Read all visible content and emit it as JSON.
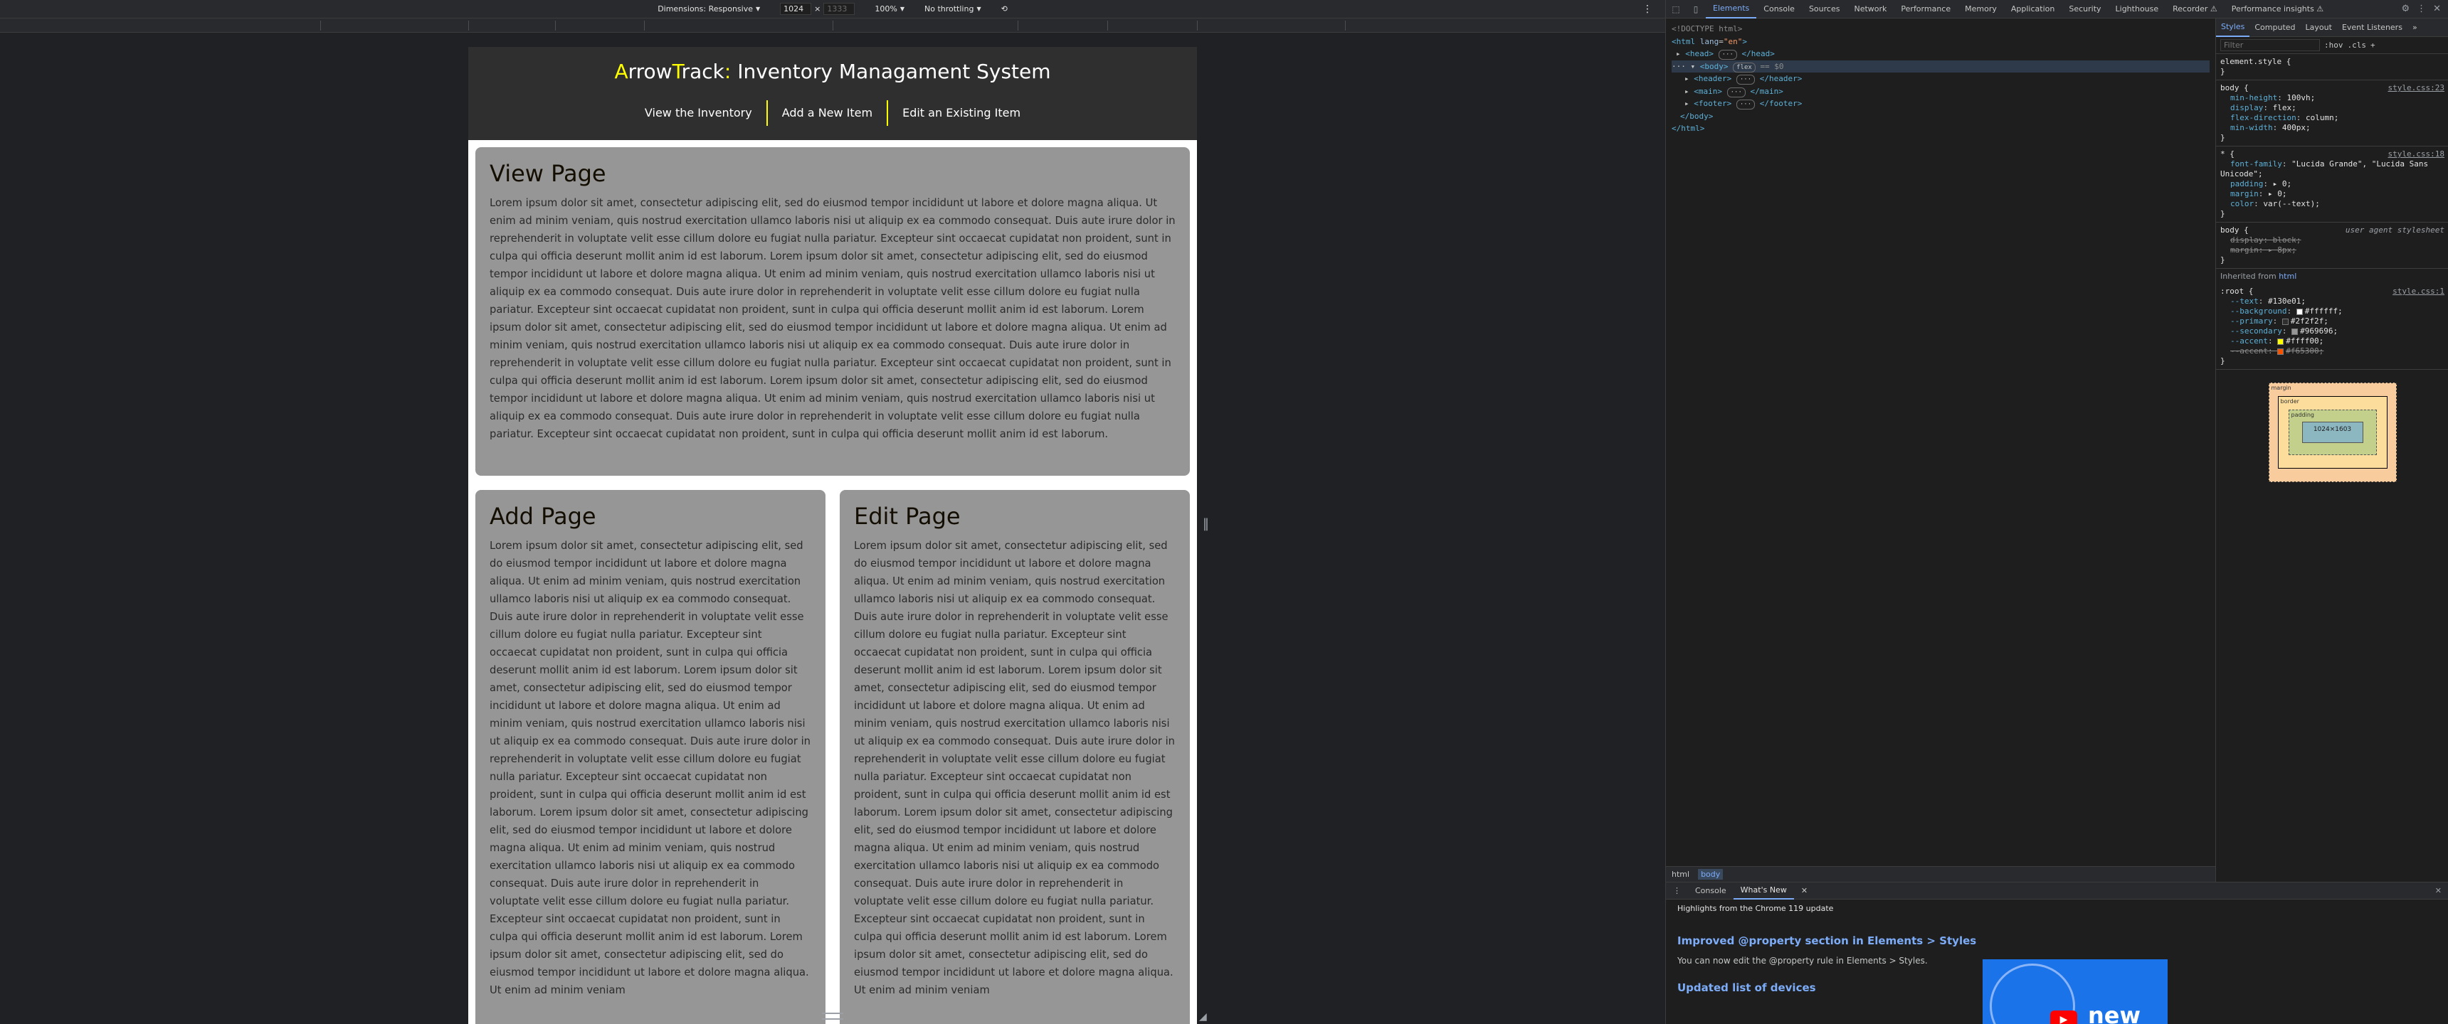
{
  "device_toolbar": {
    "dimensions_label": "Dimensions: Responsive",
    "width": "1024",
    "height": "1333",
    "separator": "×",
    "zoom": "100%",
    "throttling": "No throttling"
  },
  "site": {
    "title_first_letter": "A",
    "title_rrow": "rrow",
    "title_t": "T",
    "title_rack": "rack",
    "title_colon": ":",
    "title_rest": " Inventory Managament System",
    "nav": [
      "View the Inventory",
      "Add a New Item",
      "Edit an Existing Item"
    ],
    "view_card": {
      "heading": "View Page",
      "text": "Lorem ipsum dolor sit amet, consectetur adipiscing elit, sed do eiusmod tempor incididunt ut labore et dolore magna aliqua. Ut enim ad minim veniam, quis nostrud exercitation ullamco laboris nisi ut aliquip ex ea commodo consequat. Duis aute irure dolor in reprehenderit in voluptate velit esse cillum dolore eu fugiat nulla pariatur. Excepteur sint occaecat cupidatat non proident, sunt in culpa qui officia deserunt mollit anim id est laborum. Lorem ipsum dolor sit amet, consectetur adipiscing elit, sed do eiusmod tempor incididunt ut labore et dolore magna aliqua. Ut enim ad minim veniam, quis nostrud exercitation ullamco laboris nisi ut aliquip ex ea commodo consequat. Duis aute irure dolor in reprehenderit in voluptate velit esse cillum dolore eu fugiat nulla pariatur. Excepteur sint occaecat cupidatat non proident, sunt in culpa qui officia deserunt mollit anim id est laborum. Lorem ipsum dolor sit amet, consectetur adipiscing elit, sed do eiusmod tempor incididunt ut labore et dolore magna aliqua. Ut enim ad minim veniam, quis nostrud exercitation ullamco laboris nisi ut aliquip ex ea commodo consequat. Duis aute irure dolor in reprehenderit in voluptate velit esse cillum dolore eu fugiat nulla pariatur. Excepteur sint occaecat cupidatat non proident, sunt in culpa qui officia deserunt mollit anim id est laborum. Lorem ipsum dolor sit amet, consectetur adipiscing elit, sed do eiusmod tempor incididunt ut labore et dolore magna aliqua. Ut enim ad minim veniam, quis nostrud exercitation ullamco laboris nisi ut aliquip ex ea commodo consequat. Duis aute irure dolor in reprehenderit in voluptate velit esse cillum dolore eu fugiat nulla pariatur. Excepteur sint occaecat cupidatat non proident, sunt in culpa qui officia deserunt mollit anim id est laborum."
    },
    "add_card": {
      "heading": "Add Page",
      "text": "Lorem ipsum dolor sit amet, consectetur adipiscing elit, sed do eiusmod tempor incididunt ut labore et dolore magna aliqua. Ut enim ad minim veniam, quis nostrud exercitation ullamco laboris nisi ut aliquip ex ea commodo consequat. Duis aute irure dolor in reprehenderit in voluptate velit esse cillum dolore eu fugiat nulla pariatur. Excepteur sint occaecat cupidatat non proident, sunt in culpa qui officia deserunt mollit anim id est laborum. Lorem ipsum dolor sit amet, consectetur adipiscing elit, sed do eiusmod tempor incididunt ut labore et dolore magna aliqua. Ut enim ad minim veniam, quis nostrud exercitation ullamco laboris nisi ut aliquip ex ea commodo consequat. Duis aute irure dolor in reprehenderit in voluptate velit esse cillum dolore eu fugiat nulla pariatur. Excepteur sint occaecat cupidatat non proident, sunt in culpa qui officia deserunt mollit anim id est laborum. Lorem ipsum dolor sit amet, consectetur adipiscing elit, sed do eiusmod tempor incididunt ut labore et dolore magna aliqua. Ut enim ad minim veniam, quis nostrud exercitation ullamco laboris nisi ut aliquip ex ea commodo consequat. Duis aute irure dolor in reprehenderit in voluptate velit esse cillum dolore eu fugiat nulla pariatur. Excepteur sint occaecat cupidatat non proident, sunt in culpa qui officia deserunt mollit anim id est laborum. Lorem ipsum dolor sit amet, consectetur adipiscing elit, sed do eiusmod tempor incididunt ut labore et dolore magna aliqua. Ut enim ad minim veniam"
    },
    "edit_card": {
      "heading": "Edit Page",
      "text": "Lorem ipsum dolor sit amet, consectetur adipiscing elit, sed do eiusmod tempor incididunt ut labore et dolore magna aliqua. Ut enim ad minim veniam, quis nostrud exercitation ullamco laboris nisi ut aliquip ex ea commodo consequat. Duis aute irure dolor in reprehenderit in voluptate velit esse cillum dolore eu fugiat nulla pariatur. Excepteur sint occaecat cupidatat non proident, sunt in culpa qui officia deserunt mollit anim id est laborum. Lorem ipsum dolor sit amet, consectetur adipiscing elit, sed do eiusmod tempor incididunt ut labore et dolore magna aliqua. Ut enim ad minim veniam, quis nostrud exercitation ullamco laboris nisi ut aliquip ex ea commodo consequat. Duis aute irure dolor in reprehenderit in voluptate velit esse cillum dolore eu fugiat nulla pariatur. Excepteur sint occaecat cupidatat non proident, sunt in culpa qui officia deserunt mollit anim id est laborum. Lorem ipsum dolor sit amet, consectetur adipiscing elit, sed do eiusmod tempor incididunt ut labore et dolore magna aliqua. Ut enim ad minim veniam, quis nostrud exercitation ullamco laboris nisi ut aliquip ex ea commodo consequat. Duis aute irure dolor in reprehenderit in voluptate velit esse cillum dolore eu fugiat nulla pariatur. Excepteur sint occaecat cupidatat non proident, sunt in culpa qui officia deserunt mollit anim id est laborum. Lorem ipsum dolor sit amet, consectetur adipiscing elit, sed do eiusmod tempor incididunt ut labore et dolore magna aliqua. Ut enim ad minim veniam"
    },
    "colors": {
      "header_bg": "#2f2f2f",
      "card_bg": "#969696",
      "accent": "#ffff00",
      "text": "#130e01"
    }
  },
  "devtools": {
    "tabs": [
      "Elements",
      "Console",
      "Sources",
      "Network",
      "Performance",
      "Memory",
      "Application",
      "Security",
      "Lighthouse",
      "Recorder ⚠",
      "Performance insights ⚠"
    ],
    "active_tab": "Elements",
    "dom": {
      "doctype": "<!DOCTYPE html>",
      "html_open_tag": "html",
      "html_lang_attr": "lang",
      "html_lang_val": "\"en\"",
      "head": "head",
      "head_close": "</head>",
      "body": "body",
      "body_badge": "flex",
      "body_ref": "== $0",
      "header": "header",
      "header_close": "</header>",
      "main": "main",
      "main_close": "</main>",
      "footer": "footer",
      "footer_close": "</footer>",
      "body_close": "</body>",
      "html_close": "</html>",
      "ellipsis": "···"
    },
    "breadcrumbs": [
      "html",
      "body"
    ],
    "styles_tabs": [
      "Styles",
      "Computed",
      "Layout",
      "Event Listeners",
      "»"
    ],
    "styles_filter_placeholder": "Filter",
    "styles_tools": [
      ":hov",
      ".cls",
      "+"
    ],
    "rules": {
      "element_style": {
        "selector": "element.style {",
        "close": "}"
      },
      "body_rule": {
        "selector": "body {",
        "source": "style.css:23",
        "props": [
          {
            "name": "min-height",
            "value": "100vh;"
          },
          {
            "name": "display",
            "value": "flex;"
          },
          {
            "name": "flex-direction",
            "value": "column;"
          },
          {
            "name": "min-width",
            "value": "400px;"
          }
        ],
        "close": "}"
      },
      "star_rule": {
        "selector": "* {",
        "source": "style.css:18",
        "props": [
          {
            "name": "font-family",
            "value": "\"Lucida Grande\", \"Lucida Sans Unicode\";"
          },
          {
            "name": "padding",
            "value": "▸ 0;"
          },
          {
            "name": "margin",
            "value": "▸ 0;"
          },
          {
            "name": "color",
            "value": "var(--text);"
          }
        ],
        "close": "}"
      },
      "ua_rule": {
        "selector": "body {",
        "source": "user agent stylesheet",
        "props": [
          {
            "name": "display",
            "value": "block;"
          },
          {
            "name": "margin",
            "value": "▸ 8px;"
          }
        ],
        "close": "}"
      },
      "inherited_label": "Inherited from",
      "inherited_from": "html",
      "root_rule": {
        "selector": ":root {",
        "source": "style.css:1",
        "props": [
          {
            "name": "--text",
            "value": "#130e01;",
            "swatch": ""
          },
          {
            "name": "--background",
            "value": "#ffffff;",
            "swatch": "#ffffff"
          },
          {
            "name": "--primary",
            "value": "#2f2f2f;",
            "swatch": "#2f2f2f"
          },
          {
            "name": "--secondary",
            "value": "#969696;",
            "swatch": "#969696"
          },
          {
            "name": "--accent",
            "value": "#ffff00;",
            "swatch": "#ffff00"
          },
          {
            "name": "--accent",
            "value": "#f65300;",
            "swatch": "#f65300"
          }
        ],
        "close": "}"
      }
    },
    "box_model": {
      "margin_label": "margin",
      "border_label": "border",
      "padding_label": "padding",
      "content": "1024×1603",
      "dash": "-"
    },
    "drawer": {
      "tabs": [
        "Console",
        "What's New"
      ],
      "active_tab": "What's New",
      "subtitle": "Highlights from the Chrome 119 update",
      "items": [
        {
          "heading": "Improved @property section in Elements > Styles",
          "text": "You can now edit the @property rule in Elements > Styles."
        },
        {
          "heading": "Updated list of devices",
          "text": ""
        }
      ],
      "video_word": "new"
    }
  }
}
